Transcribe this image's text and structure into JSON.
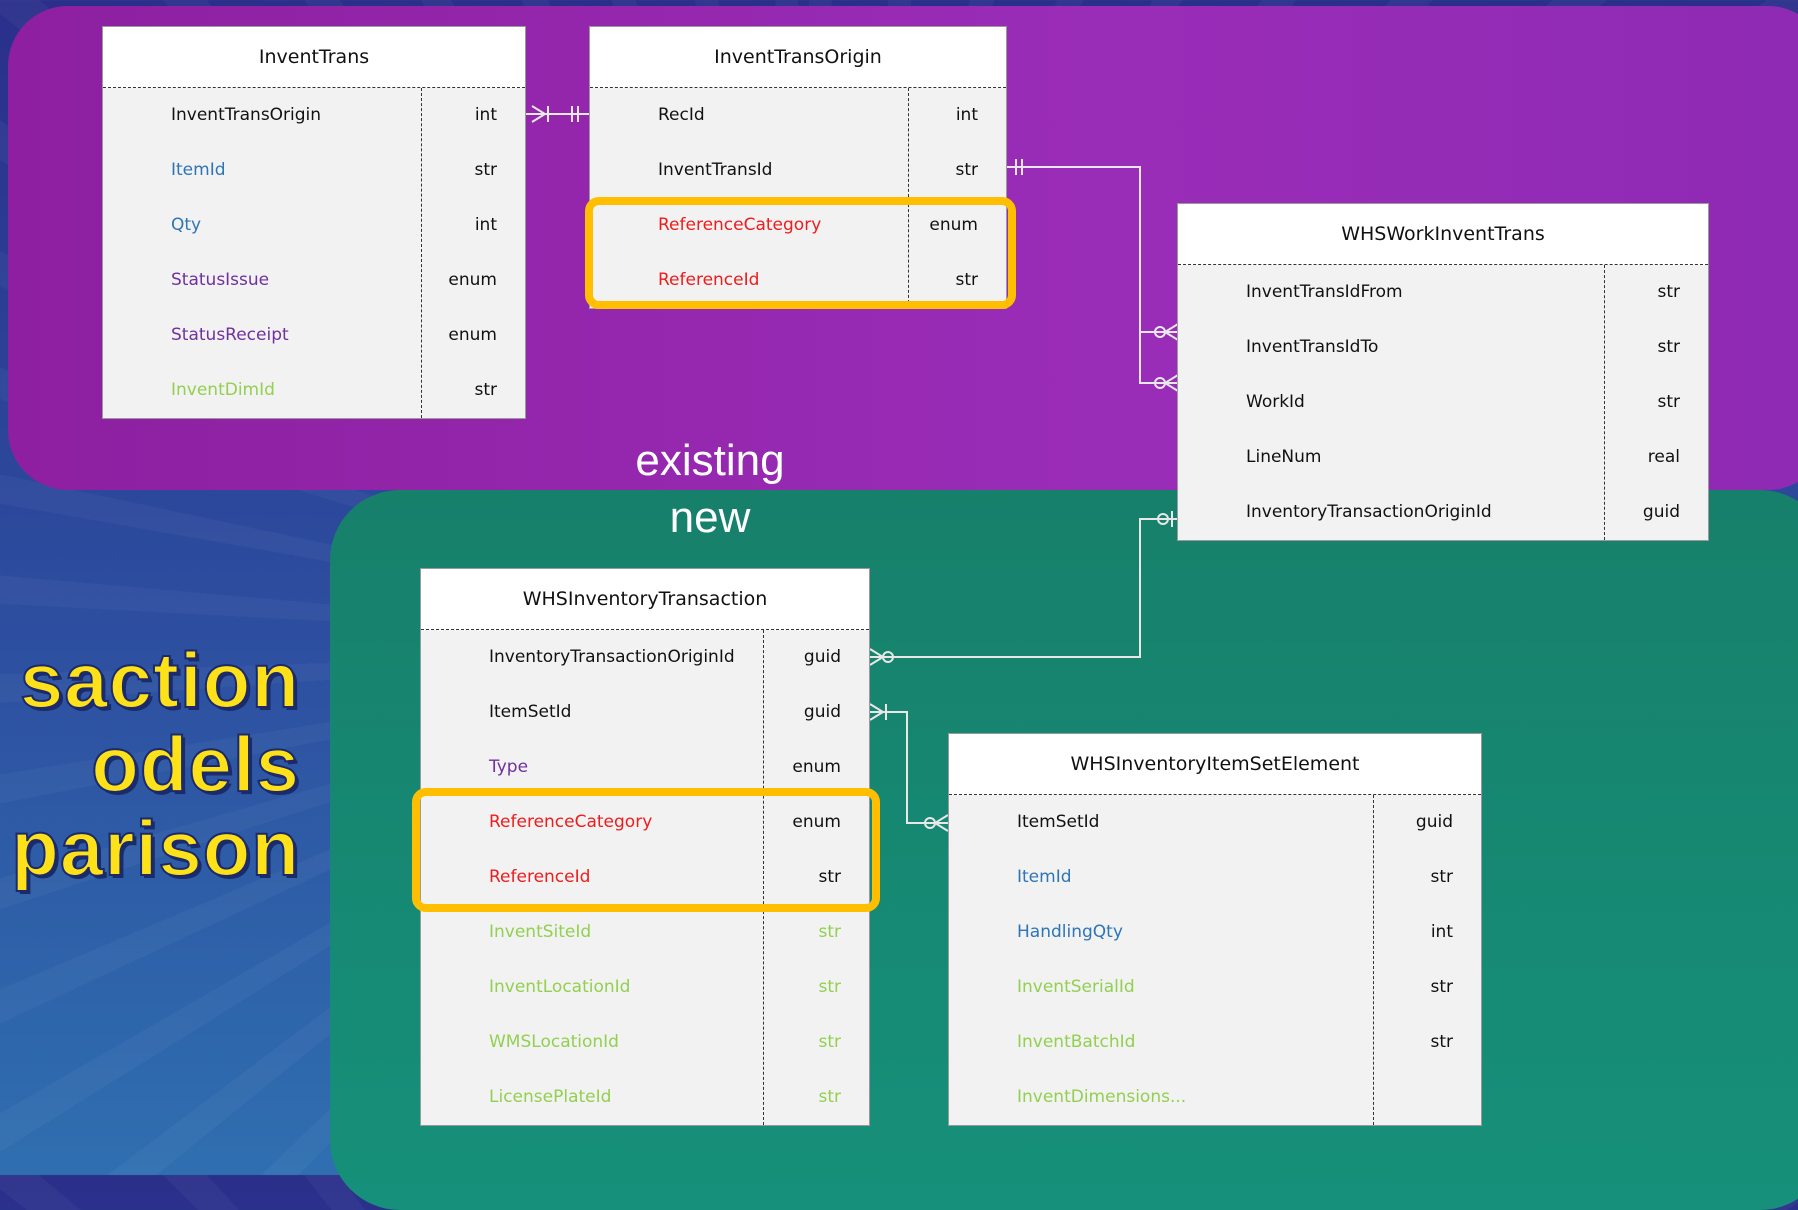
{
  "title_lines": [
    "saction",
    "odels",
    "parison"
  ],
  "region_labels": {
    "existing": "existing",
    "new": "new"
  },
  "colors": {
    "existing_region": "#9a2db8",
    "new_region": "#16907a",
    "highlight": "#ffbf00",
    "title": "#ffe11a",
    "field_black": "#111111",
    "field_blue": "#2e75b6",
    "field_purple": "#7030a0",
    "field_green": "#92d050",
    "field_red": "#ee1c1c"
  },
  "entities": [
    {
      "name": "InventTrans",
      "fields": [
        {
          "name": "InventTransOrigin",
          "type": "int",
          "color": "black"
        },
        {
          "name": "ItemId",
          "type": "str",
          "color": "blue"
        },
        {
          "name": "Qty",
          "type": "int",
          "color": "blue"
        },
        {
          "name": "StatusIssue",
          "type": "enum",
          "color": "purple"
        },
        {
          "name": "StatusReceipt",
          "type": "enum",
          "color": "purple"
        },
        {
          "name": "InventDimId",
          "type": "str",
          "color": "green"
        }
      ]
    },
    {
      "name": "InventTransOrigin",
      "fields": [
        {
          "name": "RecId",
          "type": "int",
          "color": "black"
        },
        {
          "name": "InventTransId",
          "type": "str",
          "color": "black"
        },
        {
          "name": "ReferenceCategory",
          "type": "enum",
          "color": "red"
        },
        {
          "name": "ReferenceId",
          "type": "str",
          "color": "red"
        }
      ]
    },
    {
      "name": "WHSWorkInventTrans",
      "fields": [
        {
          "name": "InventTransIdFrom",
          "type": "str",
          "color": "black"
        },
        {
          "name": "InventTransIdTo",
          "type": "str",
          "color": "black"
        },
        {
          "name": "WorkId",
          "type": "str",
          "color": "black"
        },
        {
          "name": "LineNum",
          "type": "real",
          "color": "black"
        },
        {
          "name": "InventoryTransactionOriginId",
          "type": "guid",
          "color": "black"
        }
      ]
    },
    {
      "name": "WHSInventoryTransaction",
      "fields": [
        {
          "name": "InventoryTransactionOriginId",
          "type": "guid",
          "color": "black"
        },
        {
          "name": "ItemSetId",
          "type": "guid",
          "color": "black"
        },
        {
          "name": "Type",
          "type": "enum",
          "color": "purple"
        },
        {
          "name": "ReferenceCategory",
          "type": "enum",
          "color": "red"
        },
        {
          "name": "ReferenceId",
          "type": "str",
          "color": "red"
        },
        {
          "name": "InventSiteId",
          "type": "str",
          "color": "green"
        },
        {
          "name": "InventLocationId",
          "type": "str",
          "color": "green"
        },
        {
          "name": "WMSLocationId",
          "type": "str",
          "color": "green"
        },
        {
          "name": "LicensePlateId",
          "type": "str",
          "color": "green"
        }
      ]
    },
    {
      "name": "WHSInventoryItemSetElement",
      "fields": [
        {
          "name": "ItemSetId",
          "type": "guid",
          "color": "black"
        },
        {
          "name": "ItemId",
          "type": "str",
          "color": "blue"
        },
        {
          "name": "HandlingQty",
          "type": "int",
          "color": "blue"
        },
        {
          "name": "InventSerialId",
          "type": "str",
          "color": "green"
        },
        {
          "name": "InventBatchId",
          "type": "str",
          "color": "green"
        },
        {
          "name": "InventDimensions...",
          "type": "",
          "color": "green"
        }
      ]
    }
  ]
}
